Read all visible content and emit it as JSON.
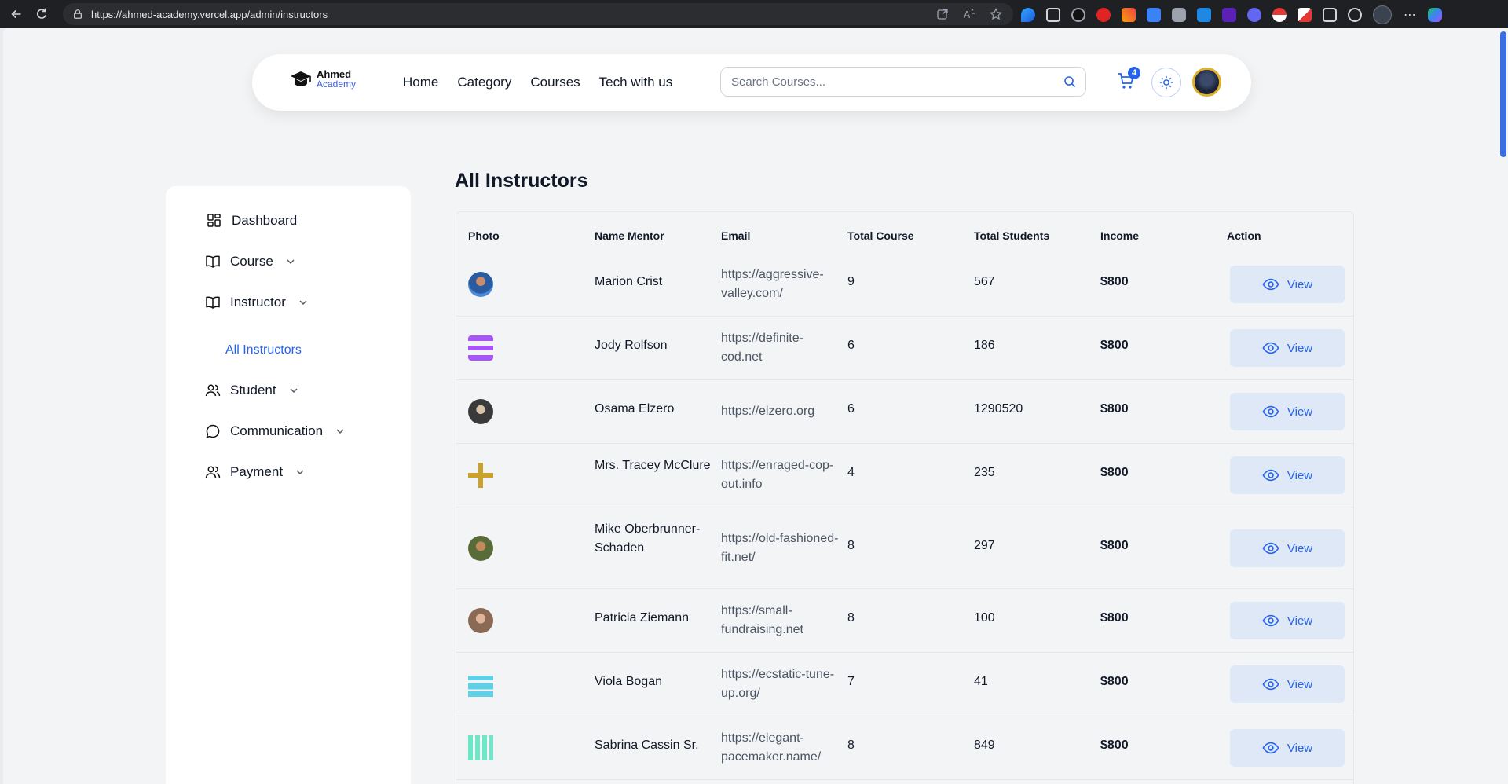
{
  "browser": {
    "url": "https://ahmed-academy.vercel.app/admin/instructors"
  },
  "header": {
    "logo_line1": "Ahmed",
    "logo_line2": "Academy",
    "nav": [
      "Home",
      "Category",
      "Courses",
      "Tech with us"
    ],
    "search_placeholder": "Search Courses...",
    "cart_count": "4"
  },
  "sidebar": {
    "items": [
      {
        "label": "Dashboard",
        "icon": "dashboard-icon"
      },
      {
        "label": "Course",
        "icon": "book-icon"
      },
      {
        "label": "Instructor",
        "icon": "book-icon"
      },
      {
        "label": "Student",
        "icon": "users-icon"
      },
      {
        "label": "Communication",
        "icon": "chat-icon"
      },
      {
        "label": "Payment",
        "icon": "users-icon"
      }
    ],
    "sub_active": "All Instructors"
  },
  "main": {
    "title": "All Instructors",
    "columns": [
      "Photo",
      "Name Mentor",
      "Email",
      "Total Course",
      "Total Students",
      "Income",
      "Action"
    ],
    "view_label": "View",
    "rows": [
      {
        "name": "Marion Crist",
        "email": "https://aggressive-valley.com/",
        "courses": "9",
        "students": "567",
        "income": "$800"
      },
      {
        "name": "Jody Rolfson",
        "email": "https://definite-cod.net",
        "courses": "6",
        "students": "186",
        "income": "$800"
      },
      {
        "name": "Osama Elzero",
        "email": "https://elzero.org",
        "courses": "6",
        "students": "1290520",
        "income": "$800"
      },
      {
        "name": "Mrs. Tracey McClure",
        "email": "https://enraged-cop-out.info",
        "courses": "4",
        "students": "235",
        "income": "$800"
      },
      {
        "name": "Mike Oberbrunner-Schaden",
        "email": "https://old-fashioned-fit.net/",
        "courses": "8",
        "students": "297",
        "income": "$800"
      },
      {
        "name": "Patricia Ziemann",
        "email": "https://small-fundraising.net",
        "courses": "8",
        "students": "100",
        "income": "$800"
      },
      {
        "name": "Viola Bogan",
        "email": "https://ecstatic-tune-up.org/",
        "courses": "7",
        "students": "41",
        "income": "$800"
      },
      {
        "name": "Sabrina Cassin Sr.",
        "email": "https://elegant-pacemaker.name/",
        "courses": "8",
        "students": "849",
        "income": "$800"
      }
    ]
  },
  "colors": {
    "accent": "#2563eb",
    "view_bg": "#dfe8f6"
  }
}
